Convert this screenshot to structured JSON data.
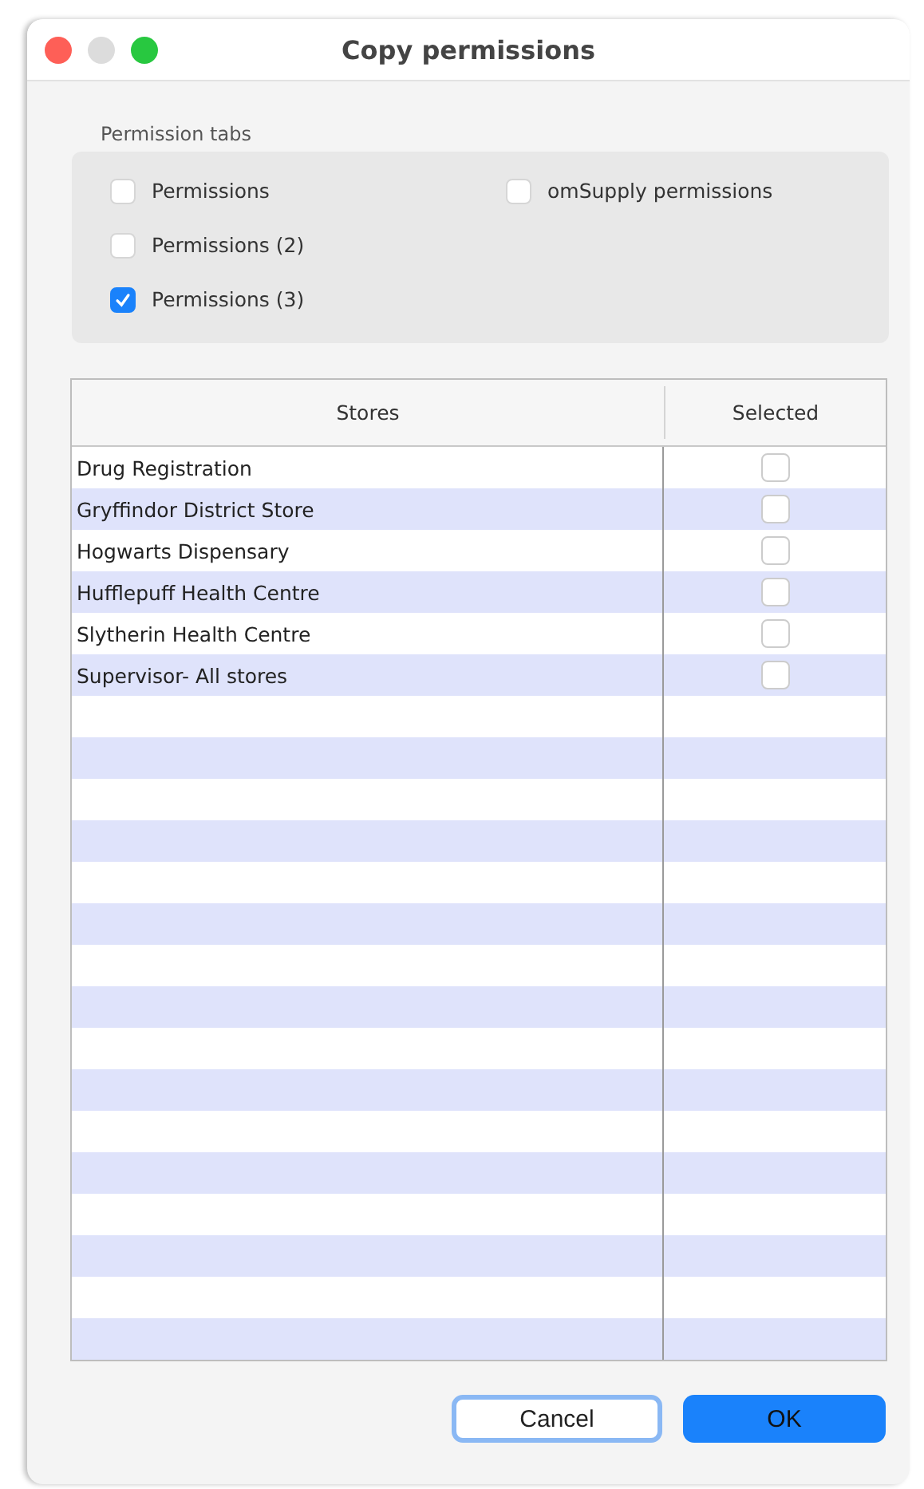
{
  "window": {
    "title": "Copy permissions"
  },
  "permission_tabs": {
    "label": "Permission tabs",
    "options": [
      {
        "label": "Permissions",
        "checked": false
      },
      {
        "label": "Permissions (2)",
        "checked": false
      },
      {
        "label": "Permissions (3)",
        "checked": true
      },
      {
        "label": "omSupply permissions",
        "checked": false
      }
    ]
  },
  "table": {
    "columns": [
      "Stores",
      "Selected"
    ],
    "rows": [
      {
        "store": "Drug Registration",
        "selected": false
      },
      {
        "store": "Gryffindor District Store",
        "selected": false
      },
      {
        "store": "Hogwarts Dispensary",
        "selected": false
      },
      {
        "store": "Hufflepuff Health Centre",
        "selected": false
      },
      {
        "store": "Slytherin Health Centre",
        "selected": false
      },
      {
        "store": "Supervisor- All stores",
        "selected": false
      }
    ]
  },
  "buttons": [
    {
      "label": "Cancel",
      "kind": "secondary"
    },
    {
      "label": "OK",
      "kind": "primary"
    }
  ]
}
